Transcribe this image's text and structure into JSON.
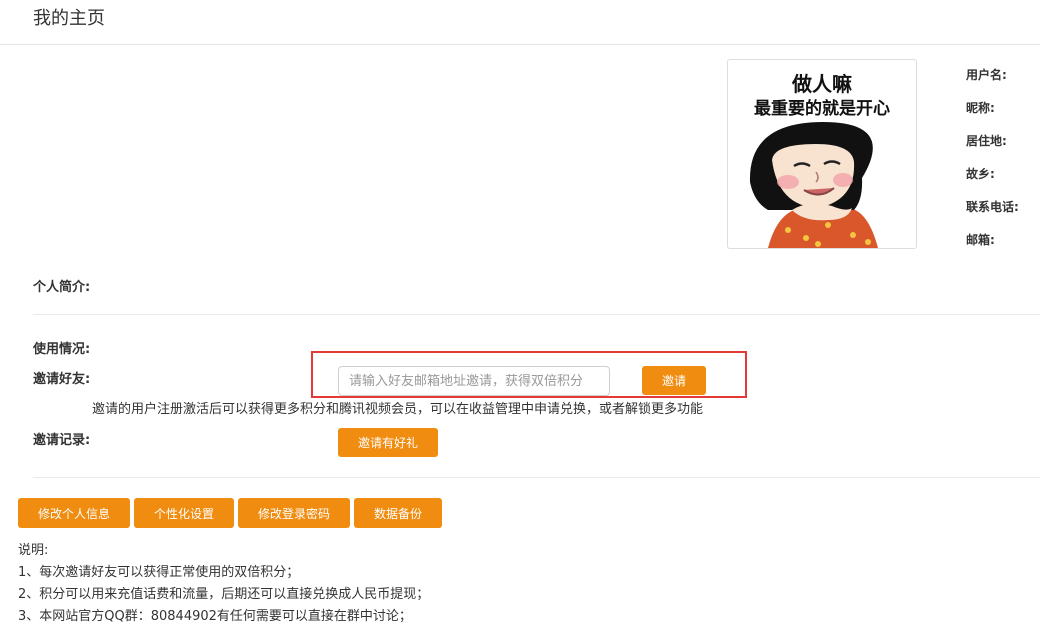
{
  "header": {
    "title": "我的主页"
  },
  "avatar": {
    "caption_line1": "做人嘛",
    "caption_line2": "最重要的就是开心"
  },
  "profile_fields": [
    {
      "label": "用户名:"
    },
    {
      "label": "昵称:"
    },
    {
      "label": "居住地:"
    },
    {
      "label": "故乡:"
    },
    {
      "label": "联系电话:"
    },
    {
      "label": "邮箱:"
    }
  ],
  "sections": {
    "bio_label": "个人简介:",
    "usage_label": "使用情况:",
    "invite_label": "邀请好友:",
    "invite_record_label": "邀请记录:"
  },
  "invite": {
    "placeholder": "请输入好友邮箱地址邀请，获得双倍积分",
    "button_label": "邀请",
    "note": "邀请的用户注册激活后可以获得更多积分和腾讯视频会员，可以在收益管理中申请兑换，或者解锁更多功能",
    "gift_button_label": "邀请有好礼"
  },
  "actions": {
    "edit_profile": "修改个人信息",
    "personalize": "个性化设置",
    "change_password": "修改登录密码",
    "backup": "数据备份"
  },
  "notes": {
    "title": "说明:",
    "items": [
      "1、每次邀请好友可以获得正常使用的双倍积分；",
      "2、积分可以用来充值话费和流量，后期还可以直接兑换成人民币提现；",
      "3、本网站官方QQ群：80844902有任何需要可以直接在群中讨论；"
    ]
  },
  "colors": {
    "accent": "#f08c0f",
    "highlight_border": "#e53935"
  }
}
